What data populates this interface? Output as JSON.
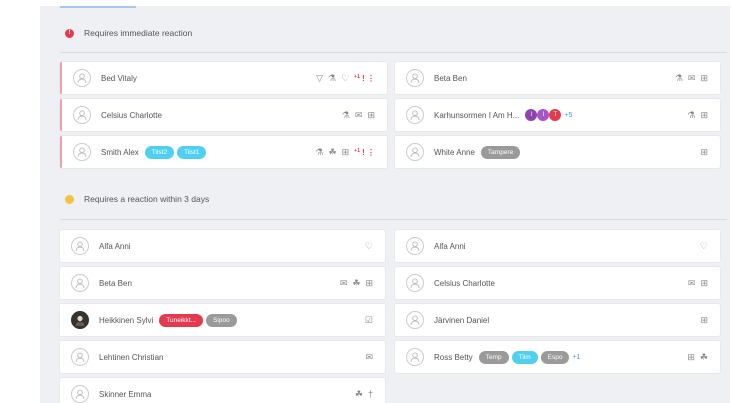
{
  "sections": [
    {
      "title": "Requires immediate reaction",
      "dot_color": "#e53950",
      "dot_symbol": "!"
    },
    {
      "title": "Requires a reaction within 3 days",
      "dot_color": "#f5c242",
      "dot_symbol": ""
    }
  ],
  "urgent": {
    "left": [
      {
        "name": "Bed Vitaly",
        "alert": true,
        "icons": [
          "wifi-icon",
          "flask-icon",
          "heart-icon"
        ],
        "excl": "!",
        "excl_count": "+1"
      },
      {
        "name": "Celsius Charlotte",
        "alert": true,
        "icons": [
          "flask-icon",
          "mail-icon",
          "plus-box-icon"
        ]
      },
      {
        "name": "Smith Alex",
        "alert": true,
        "tags": [
          {
            "label": "Tilst2",
            "color": "#4fd0f0"
          },
          {
            "label": "Tilst1",
            "color": "#4fd0f0"
          }
        ],
        "icons": [
          "flask-icon",
          "dental-icon",
          "plus-box-icon"
        ],
        "excl": "!",
        "excl_count": "+1"
      }
    ],
    "right": [
      {
        "name": "Beta Ben",
        "icons": [
          "flask-icon",
          "mail-icon",
          "plus-box-icon"
        ]
      },
      {
        "name": "Karhunsormen I Am H...",
        "badges": [
          {
            "label": "I",
            "color": "#8e44ad"
          },
          {
            "label": "I",
            "color": "#a855c8"
          },
          {
            "label": "T",
            "color": "#e53950"
          }
        ],
        "more": "+5",
        "icons": [
          "flask-icon",
          "plus-box-icon"
        ]
      },
      {
        "name": "White Anne",
        "tags": [
          {
            "label": "Tampere",
            "color": "#9a9a9a"
          }
        ],
        "icons": [
          "plus-box-icon"
        ]
      }
    ]
  },
  "soon": {
    "left": [
      {
        "name": "Alfa Anni",
        "icons": [
          "heart-icon"
        ]
      },
      {
        "name": "Beta Ben",
        "icons": [
          "mail-icon",
          "dental-icon",
          "plus-box-icon"
        ]
      },
      {
        "name": "Heikkinen Sylvi",
        "photo": true,
        "tags": [
          {
            "label": "Tuneikkt...",
            "color": "#e53950"
          },
          {
            "label": "Sipoo",
            "color": "#9a9a9a"
          }
        ],
        "icons": [
          "check-mail-icon"
        ]
      },
      {
        "name": "Lehtinen Christian",
        "icons": [
          "mail-icon"
        ]
      },
      {
        "name": "Skinner Emma",
        "icons": [
          "dental-icon",
          "pill-icon"
        ]
      }
    ],
    "right": [
      {
        "name": "Alfa Anni",
        "icons": [
          "heart-icon"
        ]
      },
      {
        "name": "Celsius Charlotte",
        "icons": [
          "mail-icon",
          "plus-box-icon"
        ]
      },
      {
        "name": "Järvinen Daniel",
        "icons": [
          "plus-box-icon"
        ]
      },
      {
        "name": "Ross Betty",
        "tags": [
          {
            "label": "Temp",
            "color": "#9a9a9a"
          },
          {
            "label": "Tilm",
            "color": "#4fd0f0"
          },
          {
            "label": "Espo",
            "color": "#9a9a9a"
          }
        ],
        "more": "+1",
        "icons": [
          "plus-box-icon",
          "dental-icon"
        ]
      }
    ]
  }
}
